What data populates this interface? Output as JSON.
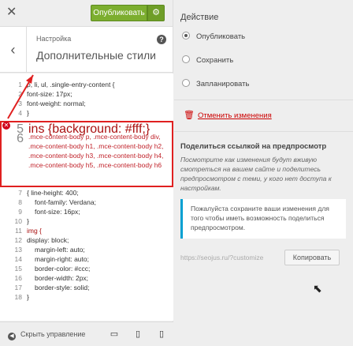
{
  "topbar": {
    "close_icon": "close-icon",
    "publish_label": "Опубликовать",
    "settings_icon": "gear-icon"
  },
  "section": {
    "breadcrumb": "Настройка",
    "title": "Дополнительные стили",
    "back_icon": "chevron-left-icon",
    "help_icon": "help-icon"
  },
  "editor": {
    "lines": [
      {
        "n": "1",
        "text": "p, li, ul, .single-entry-content {"
      },
      {
        "n": "2",
        "text": "font-size: 17px;"
      },
      {
        "n": "3",
        "text": "font-weight: normal;"
      },
      {
        "n": "4",
        "text": "}"
      },
      {
        "n": "5",
        "text": "ins {background: #fff;}"
      },
      {
        "n": "6",
        "text": ".mce-content-body p, .mce-content-body div, .mce-content-body h1, .mce-content-body h2, .mce-content-body h3, .mce-content-body h4, .mce-content-body h5, .mce-content-body h6"
      },
      {
        "n": "7",
        "text": "{   line-height: 400;"
      },
      {
        "n": "8",
        "text": "font-family: Verdana;"
      },
      {
        "n": "9",
        "text": "font-size: 16px;"
      },
      {
        "n": "10",
        "text": "}"
      },
      {
        "n": "11",
        "text": "img {"
      },
      {
        "n": "12",
        "text": "display: block;"
      },
      {
        "n": "13",
        "text": "margin-left: auto;"
      },
      {
        "n": "14",
        "text": "margin-right: auto;"
      },
      {
        "n": "15",
        "text": "border-color: #ccc;"
      },
      {
        "n": "16",
        "text": "border-width: 2px;"
      },
      {
        "n": "17",
        "text": "border-style: solid;"
      },
      {
        "n": "18",
        "text": "}"
      }
    ],
    "error_icon": "error-icon"
  },
  "bottombar": {
    "collapse_label": "Скрыть управление",
    "devices": [
      "desktop-icon",
      "tablet-icon",
      "mobile-icon"
    ]
  },
  "action": {
    "title": "Действие",
    "options": [
      {
        "label": "Опубликовать",
        "selected": true
      },
      {
        "label": "Сохранить",
        "selected": false
      },
      {
        "label": "Запланировать",
        "selected": false
      }
    ],
    "discard_label": "Отменить изменения",
    "discard_icon": "trash-icon"
  },
  "share": {
    "title": "Поделиться ссылкой на предпросмотр",
    "description": "Посмотрите как изменения будут вживую смотреться на вашем сайте и поделитесь предпросмотром с теми, у кого нет доступа к настройкам.",
    "notice": "Пожалуйста сохраните ваши изменения для того чтобы иметь возможность поделиться предпросмотром.",
    "url_placeholder": "https://seojus.ru/?customize",
    "copy_label": "Копировать"
  },
  "colors": {
    "publish": "#7cae2f",
    "highlight_border": "#e02020",
    "discard": "#cc0000",
    "notice_accent": "#00a0d2"
  }
}
